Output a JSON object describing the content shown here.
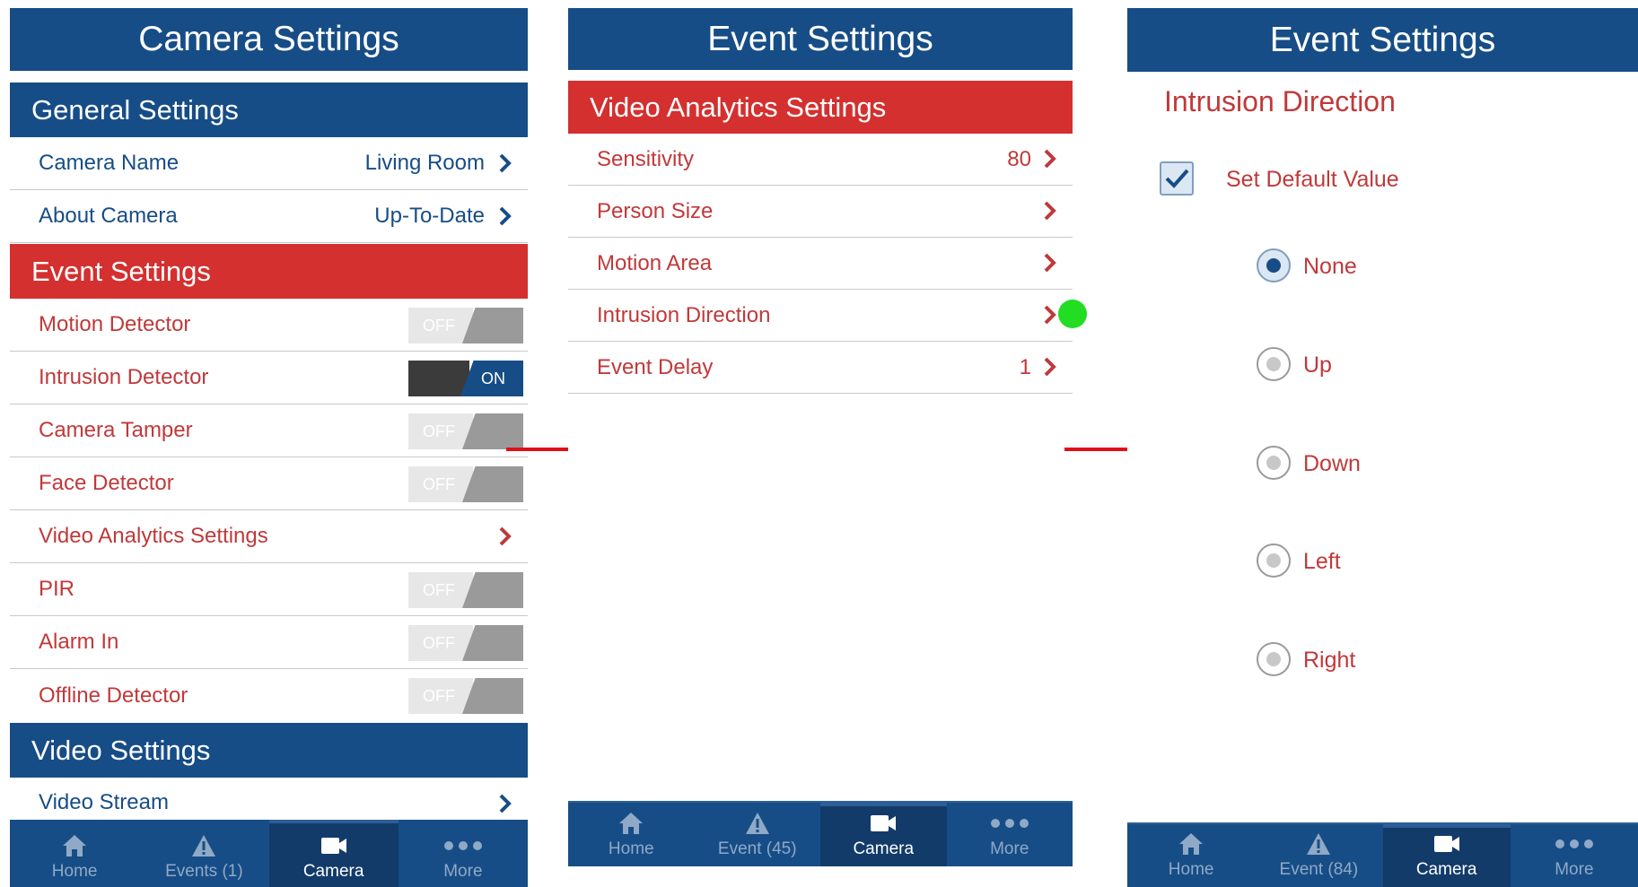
{
  "screen1": {
    "title": "Camera Settings",
    "general": {
      "header": "General Settings",
      "rows": [
        {
          "label": "Camera Name",
          "value": "Living Room"
        },
        {
          "label": "About Camera",
          "value": "Up-To-Date"
        }
      ]
    },
    "event": {
      "header": "Event Settings",
      "rows": [
        {
          "label": "Motion Detector",
          "toggle": "OFF"
        },
        {
          "label": "Intrusion Detector",
          "toggle": "ON"
        },
        {
          "label": "Camera Tamper",
          "toggle": "OFF"
        },
        {
          "label": "Face Detector",
          "toggle": "OFF"
        },
        {
          "label": "Video Analytics Settings"
        },
        {
          "label": "PIR",
          "toggle": "OFF"
        },
        {
          "label": "Alarm In",
          "toggle": "OFF"
        },
        {
          "label": "Offline Detector",
          "toggle": "OFF"
        }
      ]
    },
    "video": {
      "header": "Video Settings",
      "rows": [
        {
          "label": "Video Stream"
        }
      ]
    },
    "tabs": [
      {
        "label": "Home",
        "icon": "home-icon"
      },
      {
        "label": "Events (1)",
        "icon": "warning-icon"
      },
      {
        "label": "Camera",
        "icon": "camera-icon",
        "active": true
      },
      {
        "label": "More",
        "icon": "more-icon"
      }
    ]
  },
  "screen2": {
    "title": "Event Settings",
    "section": "Video Analytics Settings",
    "rows": [
      {
        "label": "Sensitivity",
        "value": "80"
      },
      {
        "label": "Person Size",
        "value": ""
      },
      {
        "label": "Motion Area",
        "value": ""
      },
      {
        "label": "Intrusion Direction",
        "value": ""
      },
      {
        "label": "Event Delay",
        "value": "1"
      }
    ],
    "tabs": [
      {
        "label": "Home",
        "icon": "home-icon"
      },
      {
        "label": "Event (45)",
        "icon": "warning-icon"
      },
      {
        "label": "Camera",
        "icon": "camera-icon",
        "active": true
      },
      {
        "label": "More",
        "icon": "more-icon"
      }
    ]
  },
  "screen3": {
    "title": "Event Settings",
    "heading": "Intrusion Direction",
    "checkbox": {
      "label": "Set Default Value",
      "checked": true
    },
    "options": [
      {
        "label": "None",
        "selected": true
      },
      {
        "label": "Up",
        "selected": false
      },
      {
        "label": "Down",
        "selected": false
      },
      {
        "label": "Left",
        "selected": false
      },
      {
        "label": "Right",
        "selected": false
      }
    ],
    "tabs": [
      {
        "label": "Home",
        "icon": "home-icon"
      },
      {
        "label": "Event (84)",
        "icon": "warning-icon"
      },
      {
        "label": "Camera",
        "icon": "camera-icon",
        "active": true
      },
      {
        "label": "More",
        "icon": "more-icon"
      }
    ]
  },
  "colors": {
    "header_blue": "#174d86",
    "section_red": "#d3302f",
    "text_red": "#c0393a",
    "arrow_red": "#e0101a",
    "indicator_green": "#22dd22"
  }
}
